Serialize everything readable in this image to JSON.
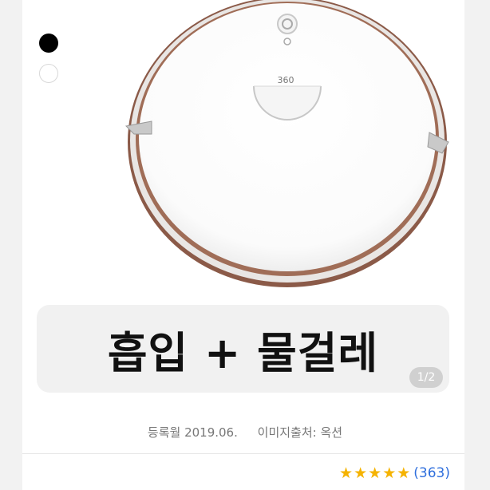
{
  "colors": {
    "accent_black": "#000000",
    "accent_white": "#ffffff",
    "star_color": "#f5b301",
    "count_color": "#2f6fdd"
  },
  "color_options": [
    "black",
    "white"
  ],
  "product": {
    "logo_text": "360"
  },
  "banner": {
    "title": "흡입 + 물걸레",
    "page_indicator": "1/2"
  },
  "meta": {
    "registered": "등록월 2019.06.",
    "image_source": "이미지출처: 옥션"
  },
  "rating": {
    "stars": 5,
    "count": "(363)"
  }
}
